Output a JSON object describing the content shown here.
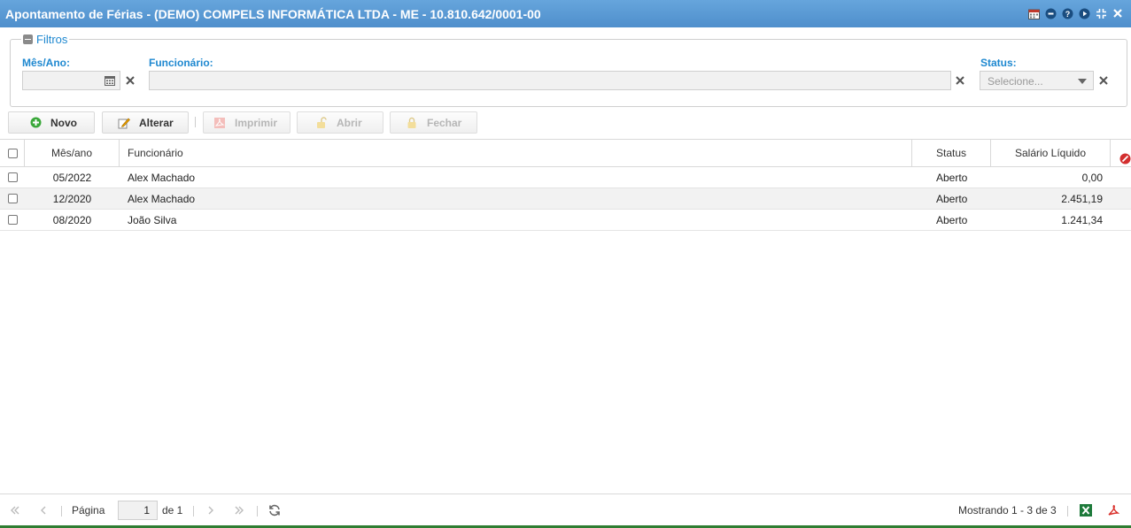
{
  "window": {
    "title": "Apontamento de Férias - (DEMO) COMPELS INFORMÁTICA LTDA - ME - 10.810.642/0001-00",
    "title_icons": [
      "calendar-icon",
      "chat-icon",
      "help-icon",
      "play-icon",
      "collapse-icon",
      "close-icon"
    ]
  },
  "filters": {
    "legend": "Filtros",
    "mes_ano_label": "Mês/Ano:",
    "mes_ano_value": "",
    "funcionario_label": "Funcionário:",
    "funcionario_value": "",
    "status_label": "Status:",
    "status_placeholder": "Selecione..."
  },
  "toolbar": {
    "novo": "Novo",
    "alterar": "Alterar",
    "imprimir": "Imprimir",
    "abrir": "Abrir",
    "fechar": "Fechar"
  },
  "grid": {
    "columns": [
      "Mês/ano",
      "Funcionário",
      "Status",
      "Salário Líquido"
    ],
    "rows": [
      {
        "mes_ano": "05/2022",
        "funcionario": "Alex Machado",
        "status": "Aberto",
        "salario": "0,00"
      },
      {
        "mes_ano": "12/2020",
        "funcionario": "Alex Machado",
        "status": "Aberto",
        "salario": "2.451,19"
      },
      {
        "mes_ano": "08/2020",
        "funcionario": "João Silva",
        "status": "Aberto",
        "salario": "1.241,34"
      }
    ]
  },
  "pager": {
    "page_label": "Página",
    "page_value": "1",
    "of_label": "de 1",
    "showing": "Mostrando 1 - 3 de 3"
  },
  "colors": {
    "titlebar": "#5b9bd5",
    "accent_label": "#1e88d0",
    "excel": "#1d7a3a",
    "pdf": "#d9302b"
  }
}
